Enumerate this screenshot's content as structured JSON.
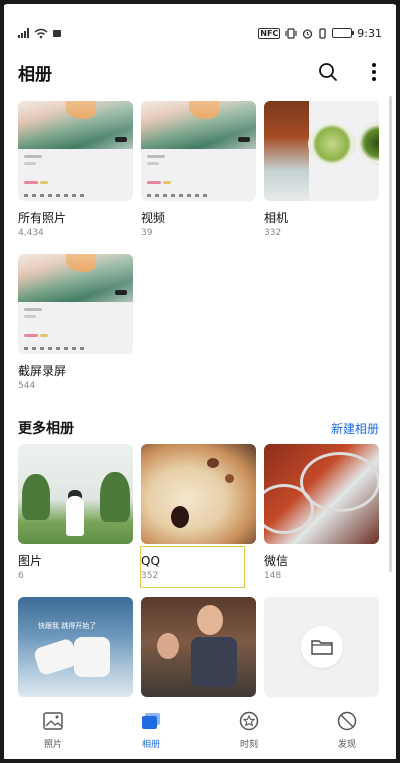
{
  "status_bar": {
    "time": "9:31",
    "nfc": "NFC"
  },
  "header": {
    "title": "相册",
    "search_icon": "search-icon",
    "more_icon": "more-vertical-icon"
  },
  "albums": [
    {
      "name": "所有照片",
      "count": "4,434"
    },
    {
      "name": "视频",
      "count": "39"
    },
    {
      "name": "相机",
      "count": "332"
    },
    {
      "name": "截屏录屏",
      "count": "544"
    }
  ],
  "more_section": {
    "title": "更多相册",
    "new_album": "新建相册"
  },
  "more_albums": [
    {
      "name": "图片",
      "count": "6"
    },
    {
      "name": "QQ",
      "count": "352"
    },
    {
      "name": "微信",
      "count": "148"
    }
  ],
  "dance_caption": "快跟我   跳得开始了",
  "bottom_nav": [
    {
      "label": "照片",
      "icon": "photo-icon",
      "active": false
    },
    {
      "label": "相册",
      "icon": "album-icon",
      "active": true
    },
    {
      "label": "时刻",
      "icon": "moments-icon",
      "active": false
    },
    {
      "label": "发现",
      "icon": "discover-icon",
      "active": false
    }
  ],
  "colors": {
    "accent": "#1e6ce0",
    "selection": "#e7c74d"
  }
}
